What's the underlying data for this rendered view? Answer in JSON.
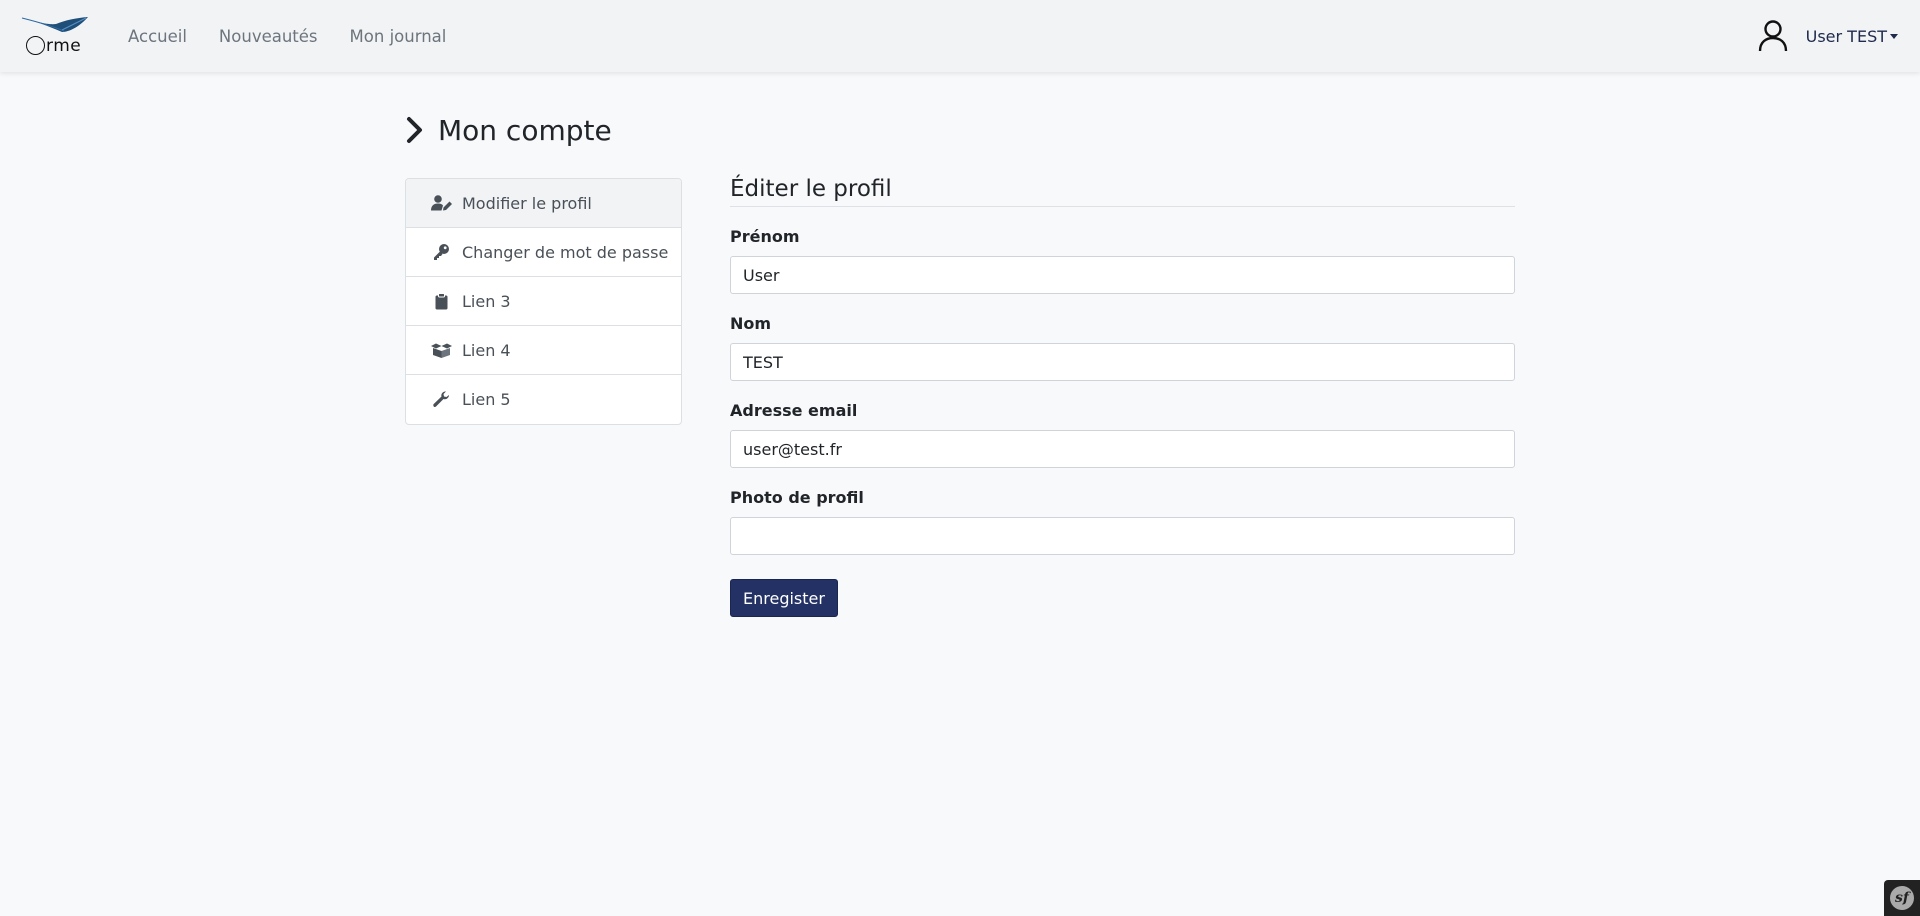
{
  "brand": {
    "name": "rme",
    "logo_icon": "feather-logo"
  },
  "nav": {
    "links": [
      {
        "label": "Accueil"
      },
      {
        "label": "Nouveautés"
      },
      {
        "label": "Mon journal"
      }
    ]
  },
  "user_menu": {
    "name": "User TEST",
    "icon": "user-icon"
  },
  "page": {
    "title": "Mon compte"
  },
  "sidebar": {
    "items": [
      {
        "label": "Modifier le profil",
        "icon": "user-edit-icon",
        "active": true
      },
      {
        "label": "Changer de mot de passe",
        "icon": "key-icon",
        "active": false
      },
      {
        "label": "Lien 3",
        "icon": "clipboard-icon",
        "active": false
      },
      {
        "label": "Lien 4",
        "icon": "boxes-icon",
        "active": false
      },
      {
        "label": "Lien 5",
        "icon": "wrench-icon",
        "active": false
      }
    ]
  },
  "form": {
    "title": "Éditer le profil",
    "fields": [
      {
        "label": "Prénom",
        "value": "User"
      },
      {
        "label": "Nom",
        "value": "TEST"
      },
      {
        "label": "Adresse email",
        "value": "user@test.fr"
      },
      {
        "label": "Photo de profil",
        "value": ""
      }
    ],
    "submit_label": "Enregister"
  },
  "debug_toolbar": {
    "logo_text": "sf"
  },
  "colors": {
    "navbar_bg": "#f2f3f5",
    "page_bg": "#f8f9fa",
    "primary_button": "#233165",
    "logo_feather": "#1f4e79"
  }
}
